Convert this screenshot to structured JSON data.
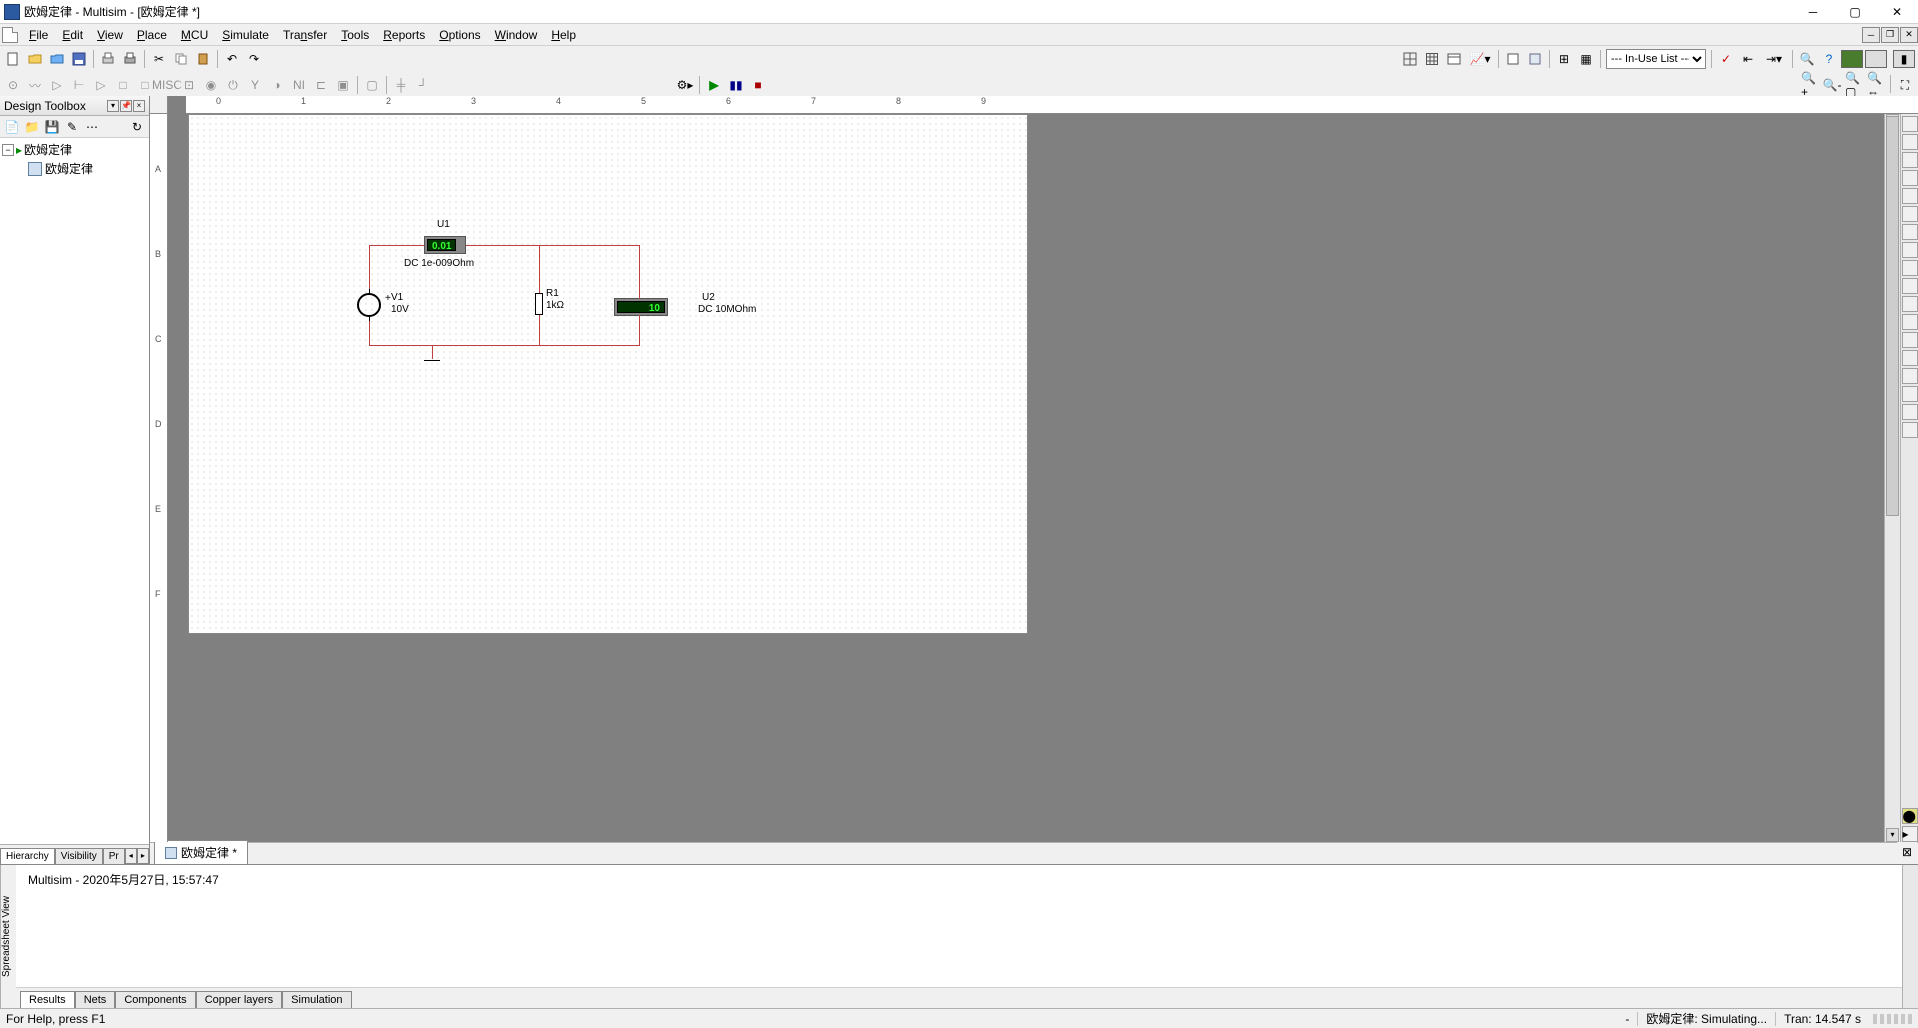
{
  "titlebar": {
    "title": "欧姆定律 - Multisim - [欧姆定律 *]"
  },
  "menus": {
    "file": "File",
    "edit": "Edit",
    "view": "View",
    "place": "Place",
    "mcu": "MCU",
    "simulate": "Simulate",
    "transfer": "Transfer",
    "tools": "Tools",
    "reports": "Reports",
    "options": "Options",
    "window": "Window",
    "help": "Help"
  },
  "toolbar": {
    "in_use_list": "--- In-Use List ---"
  },
  "sidebar": {
    "title": "Design Toolbox",
    "tree_root": "欧姆定律",
    "tree_child": "欧姆定律",
    "tabs": {
      "hierarchy": "Hierarchy",
      "visibility": "Visibility",
      "pr": "Pr"
    }
  },
  "doc_tab": {
    "label": "欧姆定律 *"
  },
  "circuit": {
    "u1": {
      "name": "U1",
      "value": "0.01",
      "desc": "DC  1e-009Ohm"
    },
    "v1": {
      "name": "V1",
      "value": "10V"
    },
    "r1": {
      "name": "R1",
      "value": "1kΩ"
    },
    "u2": {
      "name": "U2",
      "value": "10",
      "desc": "DC  10MOhm"
    }
  },
  "spreadsheet": {
    "title": "Spreadsheet View",
    "log": "Multisim  -  2020年5月27日, 15:57:47",
    "tabs": {
      "results": "Results",
      "nets": "Nets",
      "components": "Components",
      "copper": "Copper layers",
      "simulation": "Simulation"
    }
  },
  "statusbar": {
    "help": "For Help, press F1",
    "dash": "-",
    "sim": "欧姆定律: Simulating...",
    "tran": "Tran: 14.547 s"
  },
  "rulers": {
    "h": [
      "0",
      "1",
      "2",
      "3",
      "4",
      "5",
      "6",
      "7",
      "8",
      "9"
    ],
    "v": [
      "A",
      "B",
      "C",
      "D",
      "E",
      "F"
    ]
  }
}
